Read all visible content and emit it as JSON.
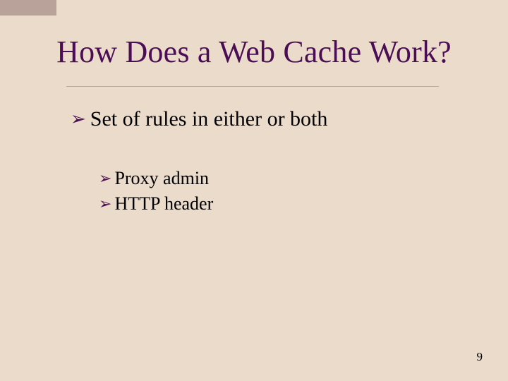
{
  "slide": {
    "title": "How Does a Web Cache Work?",
    "bullets": {
      "level1": {
        "icon": "➢",
        "text": "Set of rules in either or both"
      },
      "level2": [
        {
          "icon": "➢",
          "text": "Proxy admin"
        },
        {
          "icon": "➢",
          "text": "HTTP header"
        }
      ]
    },
    "page_number": "9"
  }
}
